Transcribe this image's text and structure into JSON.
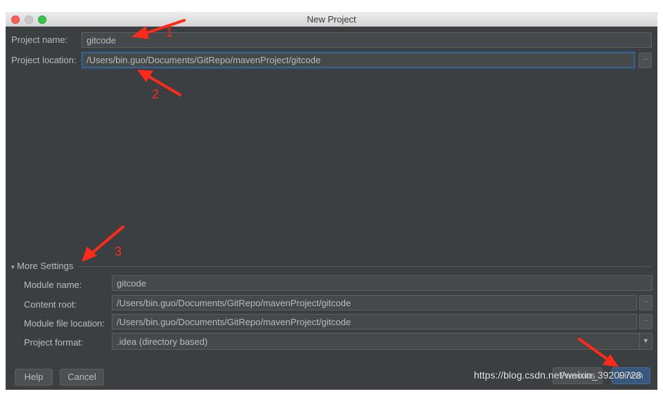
{
  "window": {
    "title": "New Project"
  },
  "project": {
    "name_label": "Project name:",
    "name_value": "gitcode",
    "location_label": "Project location:",
    "location_value": "/Users/bin.guo/Documents/GitRepo/mavenProject/gitcode",
    "browse_label": "..."
  },
  "more_settings": {
    "toggle_icon": "▾",
    "label": "More Settings",
    "module_name_label": "Module name:",
    "module_name_value": "gitcode",
    "content_root_label": "Content root:",
    "content_root_value": "/Users/bin.guo/Documents/GitRepo/mavenProject/gitcode",
    "module_file_label": "Module file location:",
    "module_file_value": "/Users/bin.guo/Documents/GitRepo/mavenProject/gitcode",
    "format_label": "Project format:",
    "format_value": ".idea (directory based)",
    "format_arrow": "▼",
    "browse_label": "..."
  },
  "buttons": {
    "help": "Help",
    "cancel": "Cancel",
    "previous": "Previous",
    "finish": "Finish"
  },
  "annotations": {
    "a1": "1",
    "a2": "2",
    "a3": "3"
  },
  "watermark": "https://blog.csdn.net/weixin_39209728",
  "colors": {
    "background": "#3c3f41",
    "field": "#45494a",
    "focus": "#3d6185",
    "annotation": "#ff2a1a",
    "primary_button": "#365880"
  }
}
